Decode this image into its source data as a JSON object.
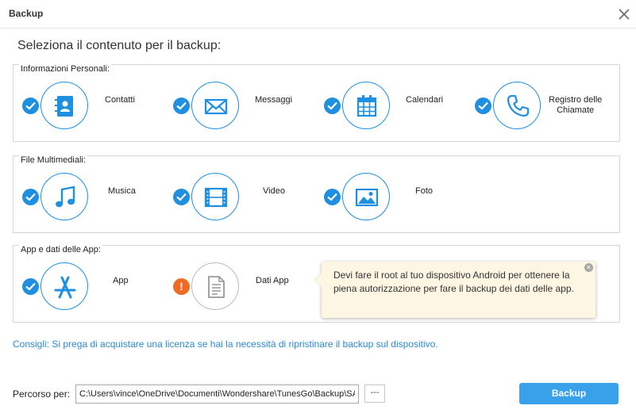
{
  "window": {
    "title": "Backup",
    "close_icon": "close-icon"
  },
  "heading": "Seleziona il contenuto per il backup:",
  "groups": [
    {
      "label": "Informazioni Personali:",
      "items": [
        {
          "label": "Contatti",
          "icon": "contacts-icon",
          "checked": true
        },
        {
          "label": "Messaggi",
          "icon": "envelope-icon",
          "checked": true
        },
        {
          "label": "Calendari",
          "icon": "calendar-icon",
          "checked": true
        },
        {
          "label_line1": "Registro delle",
          "label_line2": "Chiamate",
          "icon": "phone-icon",
          "checked": true
        }
      ]
    },
    {
      "label": "File Multimediali:",
      "items": [
        {
          "label": "Musica",
          "icon": "music-note-icon",
          "checked": true
        },
        {
          "label": "Video",
          "icon": "film-icon",
          "checked": true
        },
        {
          "label": "Foto",
          "icon": "picture-icon",
          "checked": true
        }
      ]
    },
    {
      "label": "App e dati delle App:",
      "items": [
        {
          "label": "App",
          "icon": "app-store-icon",
          "checked": true
        },
        {
          "label": "Dati App",
          "icon": "document-icon",
          "status": "warning"
        }
      ]
    }
  ],
  "popup": {
    "text": "Devi fare il root al tuo dispositivo Android per ottenere la piena autorizzazione per fare il backup dei dati delle app."
  },
  "tip": "Consigli: Si prega di acquistare una licenza se hai la necessità di ripristinare il backup sul dispositivo.",
  "footer": {
    "path_label": "Percorso per:",
    "path_value": "C:\\Users\\vince\\OneDrive\\Documenti\\Wondershare\\TunesGo\\Backup\\SAM",
    "browse_label": "---",
    "backup_label": "Backup"
  },
  "colors": {
    "accent": "#1f8fe0",
    "button": "#39a0ea",
    "warning": "#ef6a23",
    "tip": "#2a8bd0",
    "popup_bg": "#fdf6e3"
  }
}
